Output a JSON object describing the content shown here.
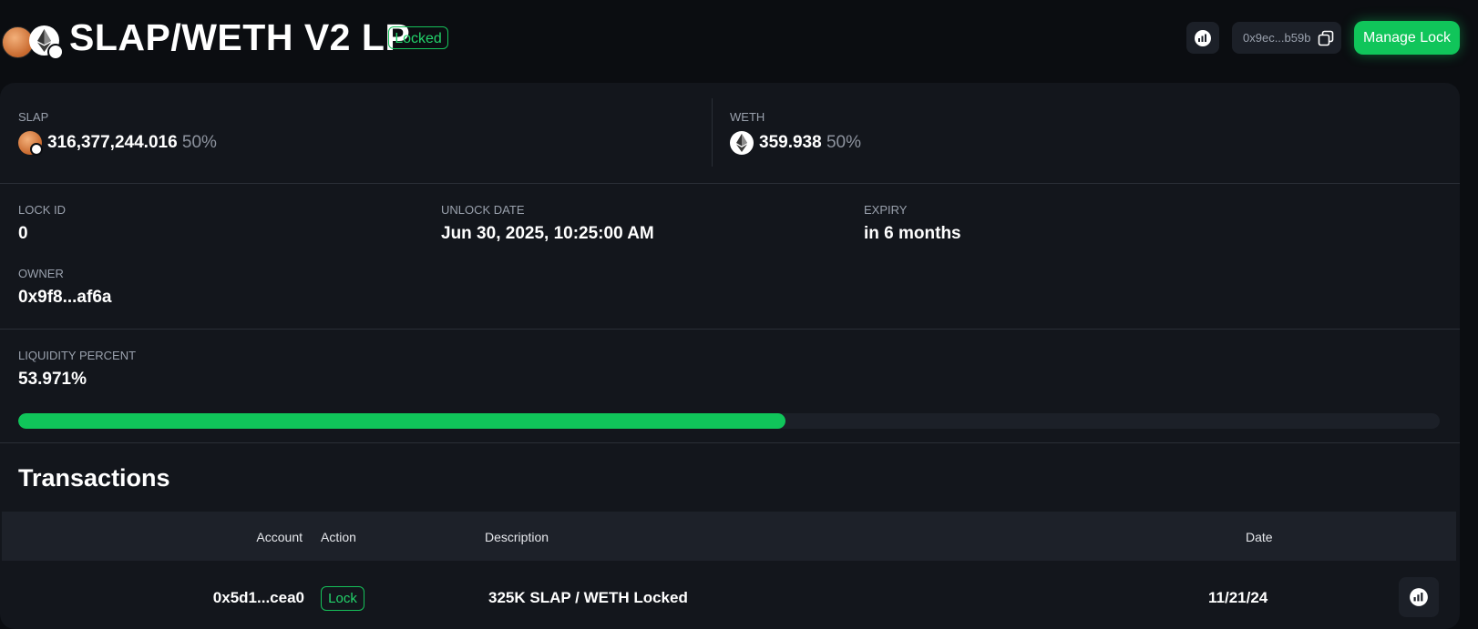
{
  "header": {
    "title": "SLAP/WETH V2 LP",
    "status_badge": "Locked",
    "token_icons": [
      "slap-token-icon",
      "eth-token-icon"
    ],
    "chart_button_icon": "chart-icon",
    "contract_address": "0x9ec...b59b",
    "copy_icon": "copy-icon",
    "manage_button": "Manage Lock"
  },
  "reserves": [
    {
      "label": "SLAP",
      "amount": "316,377,244.016",
      "percent": "50%"
    },
    {
      "label": "WETH",
      "amount": "359.938",
      "percent": "50%"
    }
  ],
  "lock_info": {
    "lock_id_label": "LOCK ID",
    "lock_id": "0",
    "unlock_date_label": "UNLOCK DATE",
    "unlock_date": "Jun 30, 2025, 10:25:00 AM",
    "expiry_label": "EXPIRY",
    "expiry": "in 6 months",
    "owner_label": "OWNER",
    "owner": "0x9f8...af6a"
  },
  "liquidity": {
    "label": "LIQUIDITY PERCENT",
    "value": "53.971%",
    "fraction": 0.53971
  },
  "transactions": {
    "title": "Transactions",
    "columns": [
      "Account",
      "Action",
      "Description",
      "Date"
    ],
    "rows": [
      {
        "account": "0x5d1...cea0",
        "action": "Lock",
        "description": "325K SLAP / WETH Locked",
        "date": "11/21/24"
      }
    ]
  },
  "colors": {
    "accent": "#10c55a",
    "background": "#0b0d11",
    "card": "#13161c",
    "muted_text": "#9aa1ad"
  }
}
